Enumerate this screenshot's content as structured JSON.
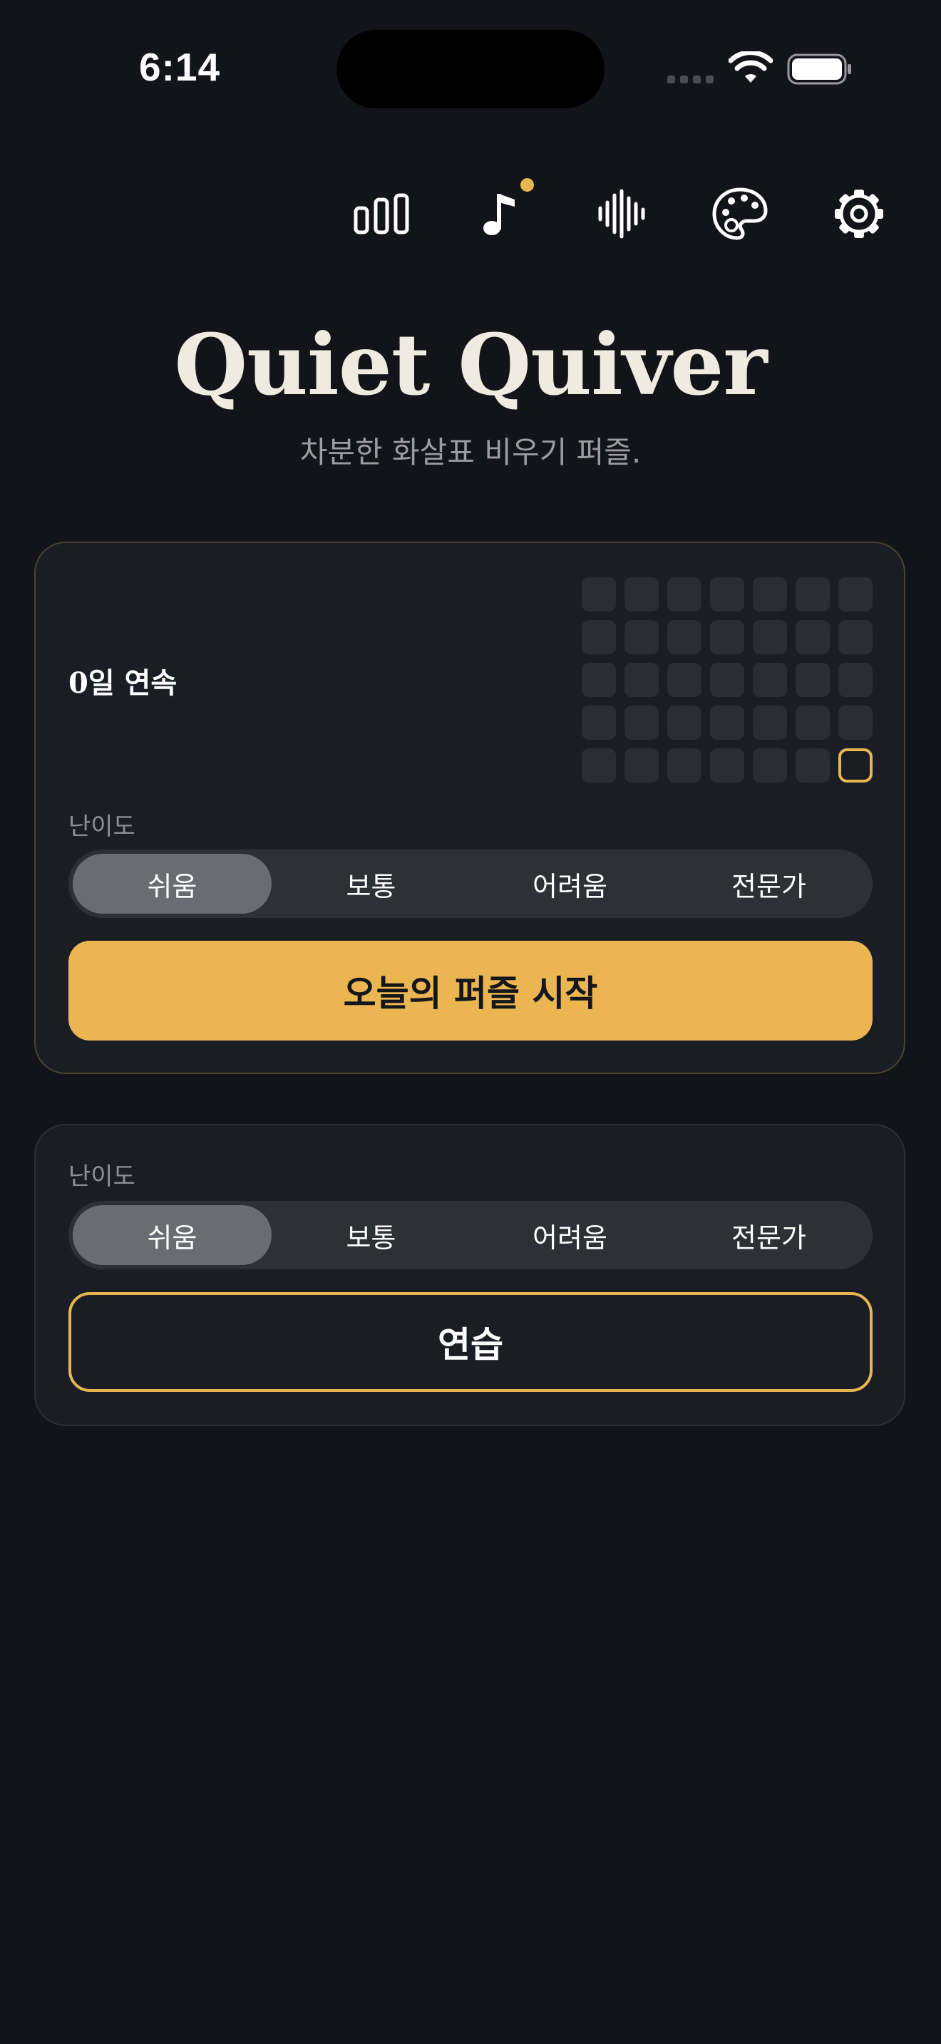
{
  "status_bar": {
    "time": "6:14"
  },
  "toolbar": {
    "icons": [
      "stats-icon",
      "music-icon",
      "sound-wave-icon",
      "palette-icon",
      "gear-icon"
    ],
    "badge_color": "#e8b651"
  },
  "header": {
    "title": "Quiet Quiver",
    "subtitle": "차분한 화살표 비우기 퍼즐."
  },
  "daily_card": {
    "streak_label": "0일 연속",
    "calendar_days": 35,
    "today_index": 34,
    "difficulty_label": "난이도",
    "difficulties": [
      "쉬움",
      "보통",
      "어려움",
      "전문가"
    ],
    "selected_difficulty": "쉬움",
    "start_button": "오늘의 퍼즐 시작"
  },
  "practice_card": {
    "difficulty_label": "난이도",
    "difficulties": [
      "쉬움",
      "보통",
      "어려움",
      "전문가"
    ],
    "selected_difficulty": "쉬움",
    "practice_button": "연습"
  },
  "colors": {
    "background": "#131419",
    "card": "#1b1d24",
    "accent": "#ebb652",
    "title": "#efebe0"
  }
}
